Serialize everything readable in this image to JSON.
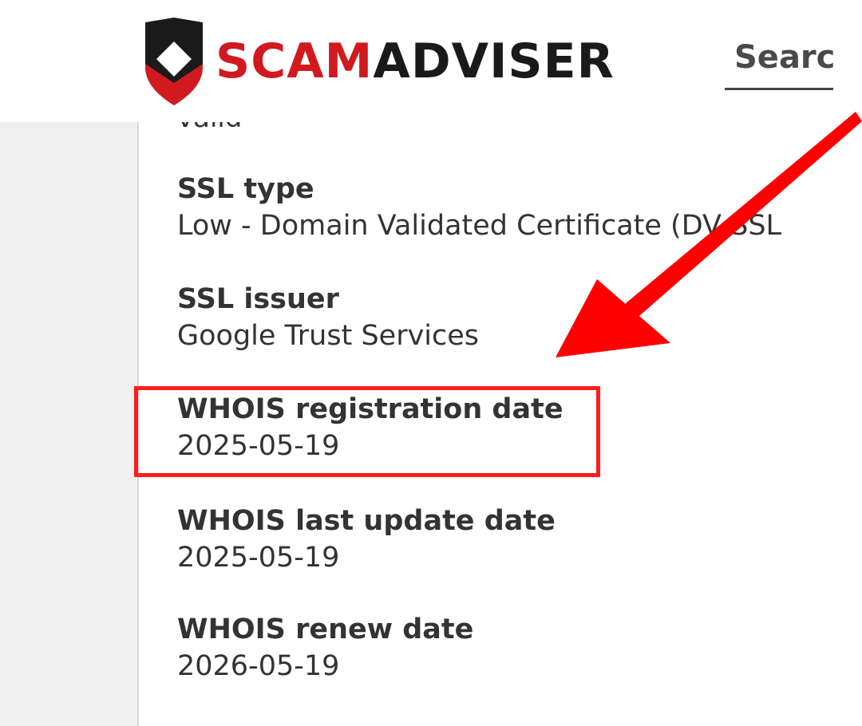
{
  "header": {
    "logo_text_scam": "SCAM",
    "logo_text_adviser": "ADVISER",
    "search_label": "Searc"
  },
  "details": {
    "cutoff_value": "valid",
    "items": [
      {
        "label": "SSL type",
        "value": "Low - Domain Validated Certificate (DV SSL"
      },
      {
        "label": "SSL issuer",
        "value": "Google Trust Services"
      },
      {
        "label": "WHOIS registration date",
        "value": "2025-05-19"
      },
      {
        "label": "WHOIS last update date",
        "value": "2025-05-19"
      },
      {
        "label": "WHOIS renew date",
        "value": "2026-05-19"
      }
    ]
  },
  "colors": {
    "brand_red": "#d11a1f",
    "brand_dark": "#1a1a1a",
    "annotation_red": "#ff1c1c",
    "sidebar_bg": "#f0f0f0"
  },
  "icons": {
    "logo": "shield-logo-icon",
    "annotation": "red-arrow-annotation"
  }
}
